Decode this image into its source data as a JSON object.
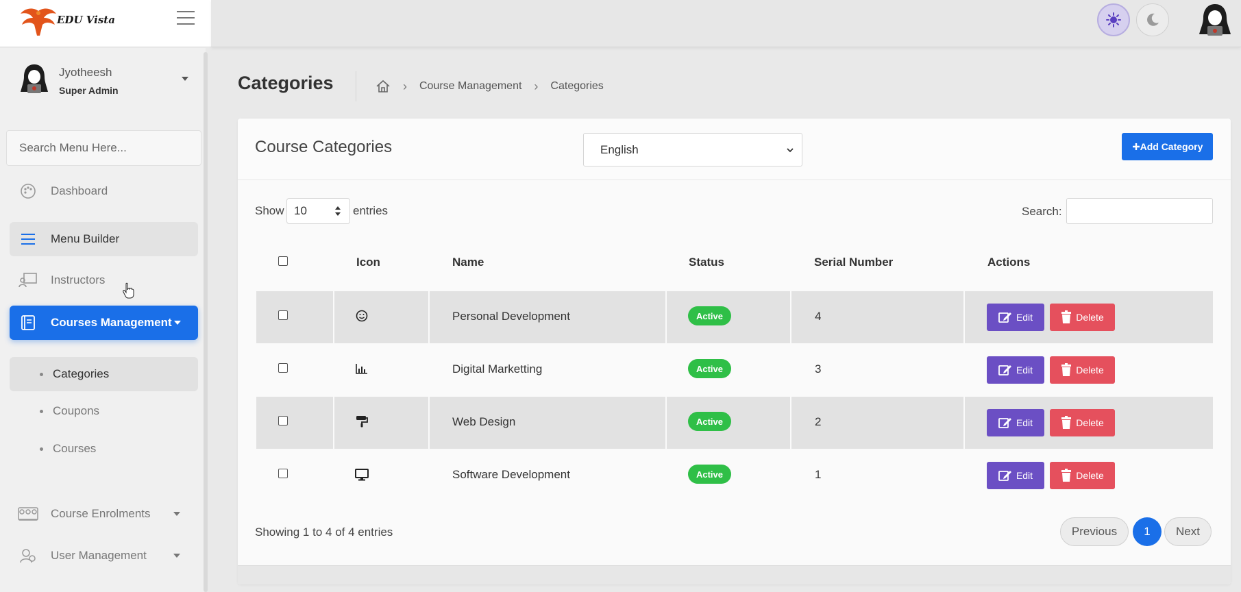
{
  "app": {
    "logo_text": "EDU Vista"
  },
  "user": {
    "name": "Jyotheesh",
    "role": "Super Admin"
  },
  "sidebar": {
    "search_placeholder": "Search Menu Here...",
    "items": [
      {
        "label": "Dashboard",
        "icon": "palette-icon"
      },
      {
        "label": "Menu Builder",
        "icon": "list-icon"
      },
      {
        "label": "Instructors",
        "icon": "instructor-icon"
      },
      {
        "label": "Courses Management",
        "icon": "book-icon"
      },
      {
        "label": "Course Enrolments",
        "icon": "group-icon"
      },
      {
        "label": "User Management",
        "icon": "users-icon"
      }
    ],
    "subitems": [
      {
        "label": "Categories"
      },
      {
        "label": "Coupons"
      },
      {
        "label": "Courses"
      }
    ]
  },
  "page": {
    "title": "Categories",
    "breadcrumb": [
      "Course Management",
      "Categories"
    ]
  },
  "card": {
    "title": "Course Categories",
    "language": "English",
    "add_label": "Add Category",
    "show_label": "Show",
    "entries_value": "10",
    "entries_label": "entries",
    "search_label": "Search:",
    "showing_text": "Showing 1 to 4 of 4 entries",
    "prev_label": "Previous",
    "next_label": "Next",
    "current_page": "1"
  },
  "table": {
    "columns": [
      "Icon",
      "Name",
      "Status",
      "Serial Number",
      "Actions"
    ],
    "rows": [
      {
        "icon": "smile-icon",
        "name": "Personal Development",
        "status": "Active",
        "serial": "4"
      },
      {
        "icon": "bar-chart-icon",
        "name": "Digital Marketting",
        "status": "Active",
        "serial": "3"
      },
      {
        "icon": "paint-roller-icon",
        "name": "Web Design",
        "status": "Active",
        "serial": "2"
      },
      {
        "icon": "desktop-icon",
        "name": "Software Development",
        "status": "Active",
        "serial": "1"
      }
    ],
    "edit_label": "Edit",
    "delete_label": "Delete"
  },
  "colors": {
    "primary": "#1a6fe8",
    "edit": "#6b4fc4",
    "delete": "#e5505d",
    "active": "#2fbf47"
  }
}
